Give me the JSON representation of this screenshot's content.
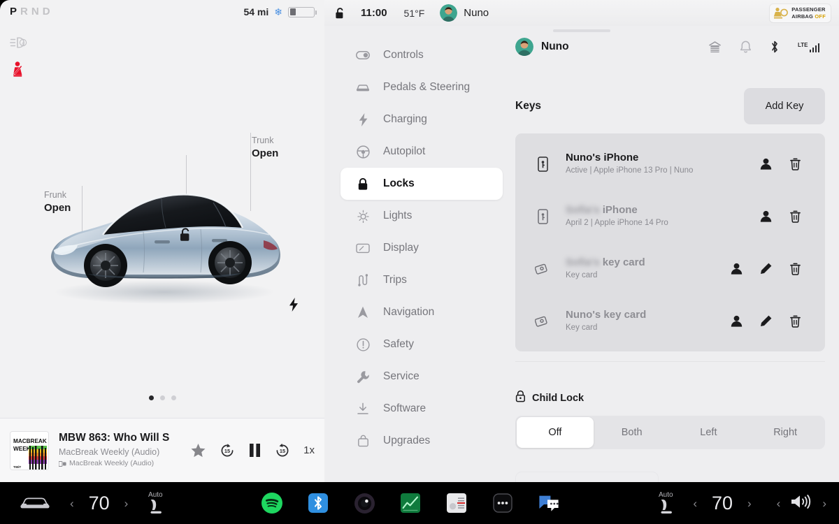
{
  "drive": {
    "gear_selected": "P",
    "gears": [
      "P",
      "R",
      "N",
      "D"
    ],
    "range": "54 mi",
    "climate_icon": "snowflake-icon",
    "battery_icon": "battery-icon",
    "telltales": [
      "auto-highbeam-icon",
      "seatbelt-warning-icon"
    ],
    "callouts": [
      {
        "label": "Frunk",
        "value": "Open"
      },
      {
        "label": "Trunk",
        "value": "Open"
      }
    ],
    "lock_icon": "unlock-icon",
    "charge_icon": "charge-bolt-icon",
    "page_dots": 3,
    "page_active": 0
  },
  "media": {
    "art_line1": "MACBREAK",
    "art_line2": "WEEKLY",
    "art_line3": "TWIT",
    "title": "MBW 863: Who Will S",
    "subtitle": "MacBreak Weekly (Audio)",
    "source": "MacBreak Weekly (Audio)",
    "favorite_icon": "star-icon",
    "back_label": "15",
    "play_state_icon": "pause-icon",
    "forward_label": "15",
    "speed": "1x"
  },
  "statusbar": {
    "lock_icon": "unlock-icon",
    "time": "11:00",
    "temperature": "51°F",
    "driver": "Nuno",
    "airbag_line1": "PASSENGER",
    "airbag_line2": "AIRBAG",
    "airbag_state": "OFF"
  },
  "sidebar": {
    "items": [
      {
        "label": "Controls",
        "icon": "toggle-icon"
      },
      {
        "label": "Pedals & Steering",
        "icon": "car-icon"
      },
      {
        "label": "Charging",
        "icon": "bolt-icon"
      },
      {
        "label": "Autopilot",
        "icon": "steering-wheel-icon"
      },
      {
        "label": "Locks",
        "icon": "lock-icon",
        "active": true
      },
      {
        "label": "Lights",
        "icon": "sun-icon"
      },
      {
        "label": "Display",
        "icon": "display-icon"
      },
      {
        "label": "Trips",
        "icon": "route-icon"
      },
      {
        "label": "Navigation",
        "icon": "navigation-arrow-icon"
      },
      {
        "label": "Safety",
        "icon": "alert-circle-icon"
      },
      {
        "label": "Service",
        "icon": "wrench-icon"
      },
      {
        "label": "Software",
        "icon": "download-icon"
      },
      {
        "label": "Upgrades",
        "icon": "bag-icon"
      }
    ]
  },
  "content": {
    "profile_name": "Nuno",
    "header_icons": [
      "garage-icon",
      "bell-icon",
      "bluetooth-icon",
      "lte-signal-icon"
    ],
    "lte_label": "LTE",
    "keys_title": "Keys",
    "add_key_label": "Add Key",
    "keys": [
      {
        "name": "Nuno's iPhone",
        "name_redacted": false,
        "detail": "Active | Apple iPhone 13 Pro | Nuno",
        "icon": "phone-key-icon",
        "actions": [
          "person-icon",
          "trash-icon"
        ],
        "dim": false
      },
      {
        "name_prefix": "Sofia's",
        "name_suffix": " iPhone",
        "name_redacted": true,
        "detail": "April 2 | Apple iPhone 14 Pro",
        "icon": "phone-key-icon",
        "actions": [
          "person-icon",
          "trash-icon"
        ],
        "dim": true
      },
      {
        "name_prefix": "Sofia's",
        "name_suffix": " key card",
        "name_redacted": true,
        "detail": "Key card",
        "icon": "key-card-icon",
        "actions": [
          "person-icon",
          "pencil-icon",
          "trash-icon"
        ],
        "dim": true
      },
      {
        "name": "Nuno's key card",
        "name_redacted": false,
        "detail": "Key card",
        "icon": "key-card-icon",
        "actions": [
          "person-icon",
          "pencil-icon",
          "trash-icon"
        ],
        "dim": true
      }
    ],
    "child_lock_title": "Child Lock",
    "child_lock_icon": "child-lock-icon",
    "child_lock_options": [
      "Off",
      "Both",
      "Left",
      "Right"
    ],
    "child_lock_selected": "Off"
  },
  "taskbar": {
    "car_icon": "car-front-icon",
    "left_climate": {
      "temp": "70",
      "prev_icon": "chevron-left-icon",
      "next_icon": "chevron-right-icon"
    },
    "left_seat": {
      "label": "Auto",
      "icon": "seat-heater-icon"
    },
    "right_seat": {
      "label": "Auto",
      "icon": "seat-heater-icon"
    },
    "right_climate": {
      "temp": "70",
      "prev_icon": "chevron-left-icon",
      "next_icon": "chevron-right-icon"
    },
    "volume": {
      "icon": "volume-icon",
      "prev_icon": "chevron-left-icon",
      "next_icon": "chevron-right-icon"
    },
    "apps": [
      {
        "name": "spotify-app-icon"
      },
      {
        "name": "bluetooth-app-icon"
      },
      {
        "name": "dashcam-app-icon"
      },
      {
        "name": "stocks-app-icon"
      },
      {
        "name": "radio-app-icon"
      },
      {
        "name": "more-app-icon"
      },
      {
        "name": "messages-app-icon"
      }
    ]
  },
  "colors": {
    "panel_bg": "#eeeef0",
    "left_bg": "#f2f2f3",
    "card_bg": "#dedee1",
    "accent_amber": "#d6a100",
    "spotify_green": "#1ed760",
    "bluetooth_blue": "#2f8fe0"
  }
}
